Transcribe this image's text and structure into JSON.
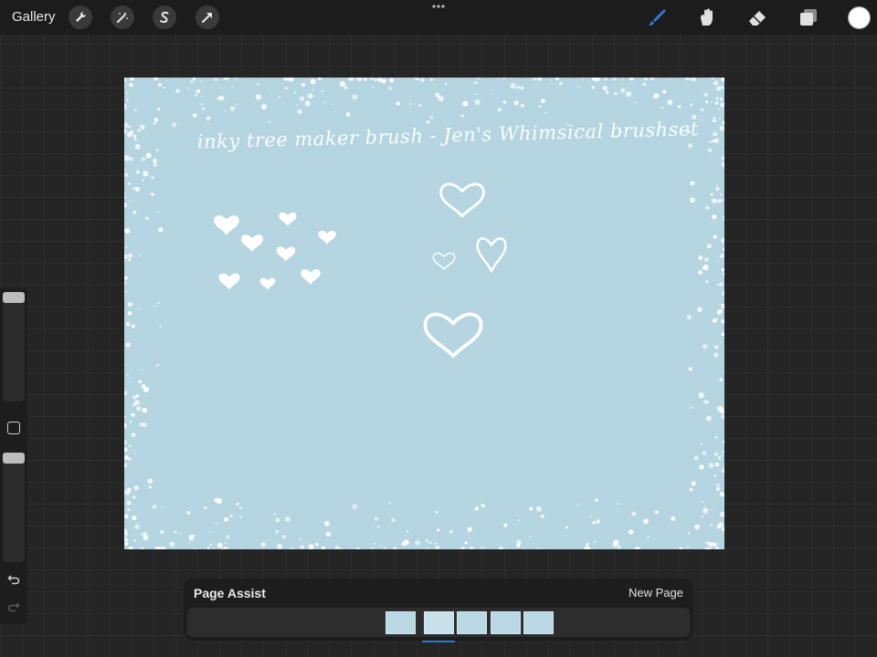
{
  "toolbar": {
    "gallery_label": "Gallery",
    "left_tools": [
      "wrench-icon",
      "magic-wand-icon",
      "selection-s-icon",
      "transform-arrow-icon"
    ],
    "right_tools": [
      "brush-icon",
      "smudge-icon",
      "eraser-icon",
      "layers-icon"
    ],
    "active_tool": "brush-icon",
    "brush_color": "#2f7bd6",
    "current_color": "#ffffff"
  },
  "sidebar": {
    "size_slider_level": 0.0,
    "opacity_slider_level": 0.0
  },
  "canvas": {
    "background": "#b3d4e0",
    "text": "inky tree maker brush - Jen's Whimsical brushset"
  },
  "page_assist": {
    "title": "Page Assist",
    "new_page_label": "New Page",
    "page_count": 5,
    "selected_page": 2
  },
  "colors": {
    "accent": "#2f7bd6",
    "canvas": "#b3d4e0"
  }
}
